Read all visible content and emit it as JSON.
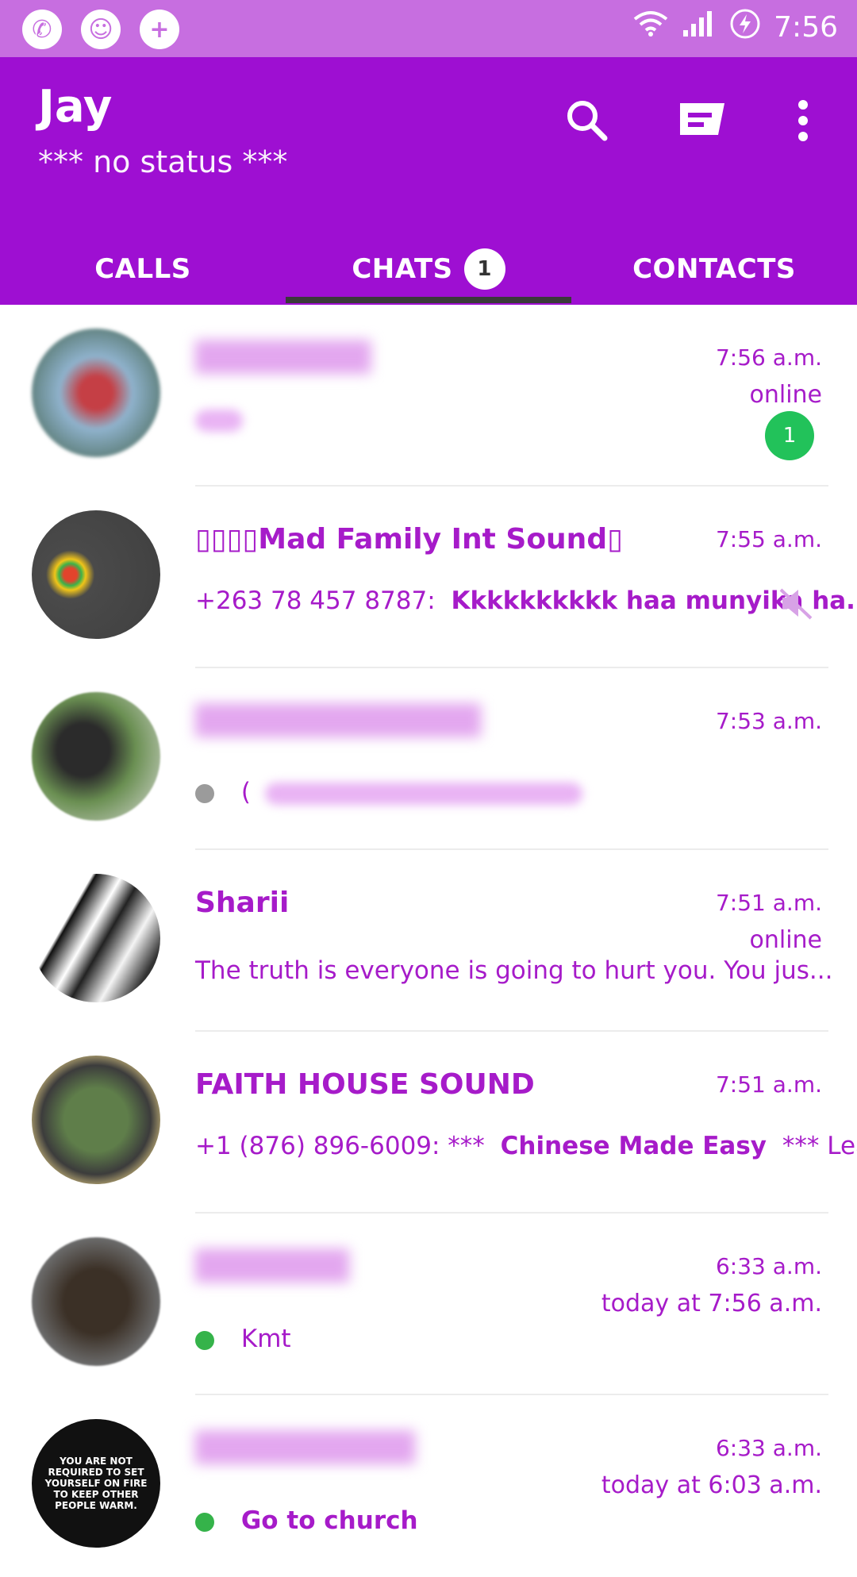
{
  "status_bar": {
    "time": "7:56"
  },
  "header": {
    "title": "Jay",
    "status": "*** no status ***"
  },
  "tabs": [
    {
      "label": "CALLS"
    },
    {
      "label": "CHATS",
      "badge": "1"
    },
    {
      "label": "CONTACTS"
    }
  ],
  "chats": [
    {
      "name": "",
      "time": "7:56 a.m.",
      "presence": "online",
      "preview": "",
      "unread": "1"
    },
    {
      "name": "▯▯▯▯Mad Family Int Sound▯",
      "time": "7:55 a.m.",
      "sender": "+263 78 457 8787:",
      "message": "Kkkkkkkkkk haa munyika ha..."
    },
    {
      "name": "",
      "time": "7:53 a.m.",
      "preview": "("
    },
    {
      "name": "Sharii",
      "time": "7:51 a.m.",
      "presence": "online",
      "preview": "The truth is everyone is going to hurt you. You jus..."
    },
    {
      "name": "FAITH HOUSE SOUND",
      "time": "7:51 a.m.",
      "sender": "+1 (876) 896-6009: ***",
      "message": "Chinese Made Easy",
      "suffix": "*** Lea..."
    },
    {
      "name": "",
      "time": "6:33 a.m.",
      "presence": "today at 7:56 a.m.",
      "preview": "Kmt"
    },
    {
      "name": "",
      "time": "6:33 a.m.",
      "presence": "today at 6:03 a.m.",
      "preview": "Go to church",
      "avatar_text": "YOU ARE NOT REQUIRED TO SET YOURSELF ON FIRE TO KEEP OTHER PEOPLE WARM."
    }
  ],
  "colors": {
    "primary": "#9e0fd2",
    "status_bar": "#c76ee0",
    "accent_text": "#a61bc9",
    "online_dot": "#35b34a",
    "unread_badge": "#22c25a"
  }
}
